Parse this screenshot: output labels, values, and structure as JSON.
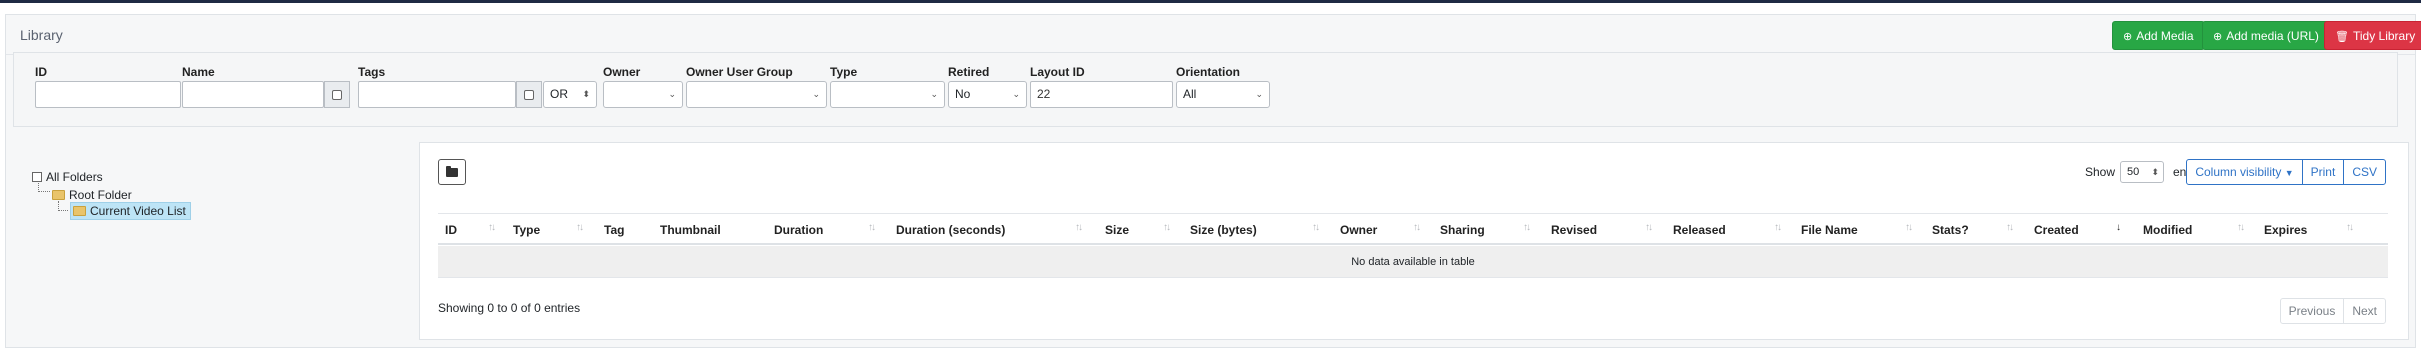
{
  "page": {
    "title": "Library"
  },
  "header_buttons": {
    "add_media": "Add Media",
    "add_media_url": "Add media (URL)",
    "tidy_library": "Tidy Library"
  },
  "filters": {
    "id": {
      "label": "ID",
      "value": ""
    },
    "name": {
      "label": "Name",
      "value": ""
    },
    "tags": {
      "label": "Tags",
      "value": "",
      "operator": "OR"
    },
    "owner": {
      "label": "Owner",
      "value": ""
    },
    "owner_user_group": {
      "label": "Owner User Group",
      "value": ""
    },
    "type": {
      "label": "Type",
      "value": ""
    },
    "retired": {
      "label": "Retired",
      "value": "No"
    },
    "layout_id": {
      "label": "Layout ID",
      "value": "22"
    },
    "orientation": {
      "label": "Orientation",
      "value": "All"
    }
  },
  "tree": {
    "all_folders": "All Folders",
    "root_folder": "Root Folder",
    "current_node": "Current Video List"
  },
  "table": {
    "show_label": "Show",
    "page_size": "50",
    "entries_label": "entries",
    "column_visibility": "Column visibility",
    "print": "Print",
    "csv": "CSV",
    "columns": [
      "ID",
      "Type",
      "Tag",
      "Thumbnail",
      "Duration",
      "Duration (seconds)",
      "Size",
      "Size (bytes)",
      "Owner",
      "Sharing",
      "Revised",
      "Released",
      "File Name",
      "Stats?",
      "Created",
      "Modified",
      "Expires"
    ],
    "empty_message": "No data available in table",
    "info": "Showing 0 to 0 of 0 entries",
    "previous": "Previous",
    "next": "Next"
  },
  "colors": {
    "green": "#28a745",
    "red": "#dc3545",
    "primary_outline": "#2f73c6",
    "topbar": "#1f2a44"
  }
}
